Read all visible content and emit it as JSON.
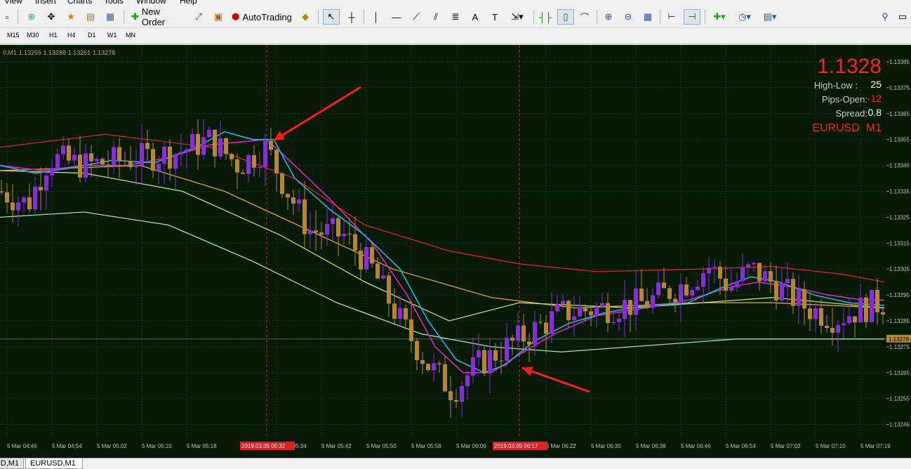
{
  "menu": [
    "View",
    "Insert",
    "Charts",
    "Tools",
    "Window",
    "Help"
  ],
  "toolbar": {
    "new_order_label": "New Order",
    "autotrading_label": "AutoTrading",
    "icons": [
      "new-chart-icon",
      "market-watch-icon",
      "navigator-icon",
      "favorites-icon",
      "new-order-icon",
      "expert-editor-icon",
      "autotrading-icon",
      "signals-icon",
      "cursor-icon",
      "crosshair-icon",
      "vertical-line-icon",
      "horizontal-line-icon",
      "trendline-icon",
      "channel-icon",
      "fibonacci-icon",
      "text-icon",
      "text-label-icon",
      "arrows-icon",
      "bar-chart-icon",
      "candlestick-icon",
      "line-chart-icon",
      "zoom-in-icon",
      "zoom-out-icon",
      "tile-windows-icon",
      "chart-shift-icon",
      "autoscroll-icon",
      "indicators-icon",
      "periods-icon",
      "templates-icon",
      "search-icon",
      "maximize-icon"
    ]
  },
  "timeframes": [
    "M15",
    "M30",
    "H1",
    "H4",
    "D1",
    "W1",
    "MN"
  ],
  "chart": {
    "header": "0,M1  1.13265 1.13288 1.13261 1.13278",
    "price_big": "1.1328",
    "high_low_label": "High-Low :",
    "high_low_value": "25",
    "pips_open_label": "Pips-Open:",
    "pips_open_value": "-12",
    "spread_label": "Spread:",
    "spread_value": "0.8",
    "symbol_label": "EURUSD  M1",
    "current_price_tag": "1.13278",
    "price_axis": [
      "1.13385",
      "1.13375",
      "1.13365",
      "1.13355",
      "1.13345",
      "1.13335",
      "1.13325",
      "1.13315",
      "1.13305",
      "1.13295",
      "1.13285",
      "1.13275",
      "1.13265",
      "1.13255",
      "1.13245"
    ],
    "time_axis": [
      "5 Mar 04:46",
      "5 Mar 04:54",
      "5 Mar 05:02",
      "5 Mar 05:10",
      "5 Mar 05:18",
      "5 Mar 05:34",
      "5 Mar 05:42",
      "5 Mar 05:50",
      "5 Mar 05:58",
      "5 Mar 06:06",
      "5 Mar 06:22",
      "5 Mar 06:30",
      "5 Mar 06:38",
      "5 Mar 06:46",
      "5 Mar 06:54",
      "5 Mar 07:02",
      "5 Mar 07:10",
      "5 Mar 07:19"
    ],
    "vline_labels": [
      "2019.03.05 05:32",
      "2019.03.05 06:17"
    ],
    "colors": {
      "background": "#061a06",
      "grid": "#1f4a1f",
      "bull": "#8a2be2",
      "bear": "#b8862b",
      "ma_fast": "#1eb4e6",
      "ma_mid": "#e21ed2",
      "ma_red": "#e02020",
      "ma_orange": "#e8a020",
      "ma_green": "#b8e070",
      "ma_slow": "#a0e0c0",
      "arrow": "#ff1a1a",
      "red_text": "#ff2020"
    }
  },
  "tabs": [
    "D,M1",
    "EURUSD,M1"
  ]
}
